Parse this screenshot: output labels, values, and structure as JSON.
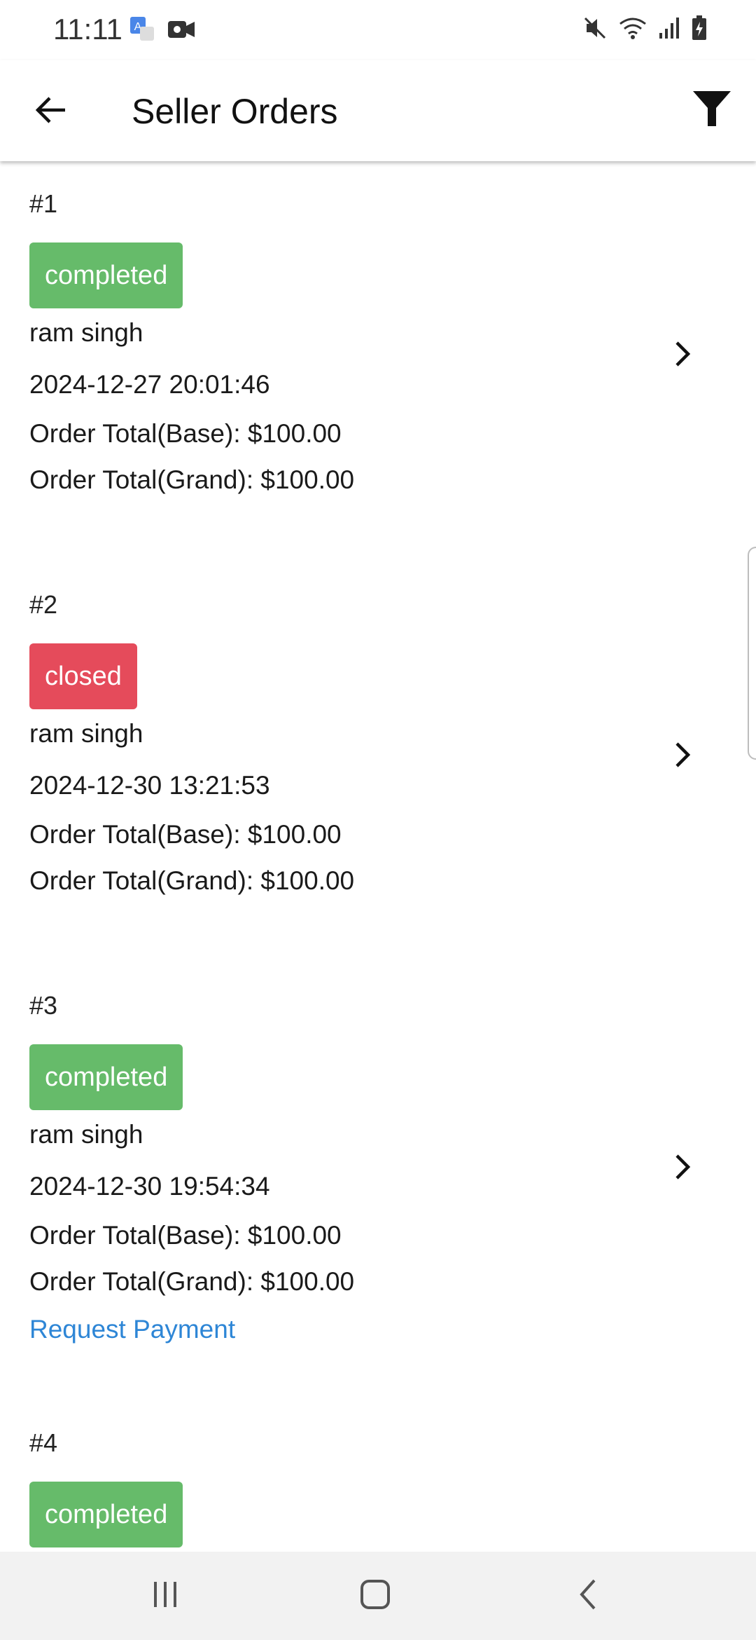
{
  "status_bar": {
    "time": "11:11",
    "left_icons": [
      "translate-icon",
      "video-camera-icon"
    ],
    "right_icons": [
      "mute-icon",
      "wifi-icon",
      "signal-icon",
      "battery-charging-icon"
    ]
  },
  "app_bar": {
    "title": "Seller Orders",
    "back_icon": "arrow-left-icon",
    "filter_icon": "filter-icon"
  },
  "orders": [
    {
      "id": "#1",
      "status": "completed",
      "customer": "ram singh",
      "date": "2024-12-27 20:01:46",
      "total_base": "Order Total(Base): $100.00",
      "total_grand": "Order Total(Grand): $100.00"
    },
    {
      "id": "#2",
      "status": "closed",
      "customer": "ram singh",
      "date": "2024-12-30 13:21:53",
      "total_base": "Order Total(Base): $100.00",
      "total_grand": "Order Total(Grand): $100.00"
    },
    {
      "id": "#3",
      "status": "completed",
      "customer": "ram singh",
      "date": "2024-12-30 19:54:34",
      "total_base": "Order Total(Base): $100.00",
      "total_grand": "Order Total(Grand): $100.00",
      "action": "Request Payment"
    },
    {
      "id": "#4",
      "status": "completed"
    }
  ],
  "colors": {
    "completed": "#66bb6a",
    "closed": "#e54b5b",
    "link": "#2e86d6"
  },
  "nav_bar": {
    "buttons": [
      "recent-apps-icon",
      "home-icon",
      "back-icon"
    ]
  }
}
